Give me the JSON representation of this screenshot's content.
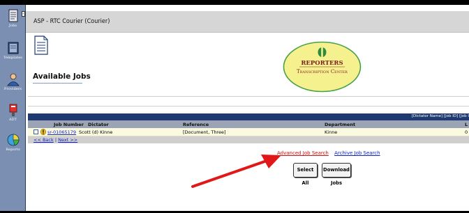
{
  "window": {
    "title": "ASP - RTC Courier (Courier)"
  },
  "sidebar": {
    "items": [
      {
        "label": "Jobs",
        "icon": "jobs-icon"
      },
      {
        "label": "Templates",
        "icon": "templates-icon"
      },
      {
        "label": "Providers",
        "icon": "providers-icon"
      },
      {
        "label": "ADT",
        "icon": "adt-icon"
      },
      {
        "label": "Reports",
        "icon": "reports-icon"
      }
    ]
  },
  "page": {
    "title": "Available Jobs"
  },
  "logo": {
    "line1": "Reporters",
    "line2": "Transcription Center",
    "fill_color": "#f6f18f",
    "border_color": "#49a049",
    "text_color": "#7a1d1d"
  },
  "grid": {
    "sort_links": "[Dictator Name] [Job ID] [Job I",
    "columns": [
      "Job Number",
      "Dictator",
      "Reference",
      "Department",
      "L"
    ],
    "rows": [
      {
        "job_number": "sr-01065179",
        "dictator": "Scott (d) Kinne",
        "reference": "[Document, Three]",
        "department": "Kinne",
        "l": "0"
      }
    ],
    "nav": {
      "back": "<< Back",
      "separator": "|",
      "next": "Next >>"
    }
  },
  "links": {
    "advanced_search": "Advanced Job Search",
    "archive_search": "Archive Job Search"
  },
  "buttons": {
    "select_all": "Select All",
    "download_jobs": "Download Jobs"
  },
  "colors": {
    "sidebar": "#7b8fb2",
    "grid_header_bar": "#1e3a70",
    "annotation_arrow": "#e01818"
  }
}
